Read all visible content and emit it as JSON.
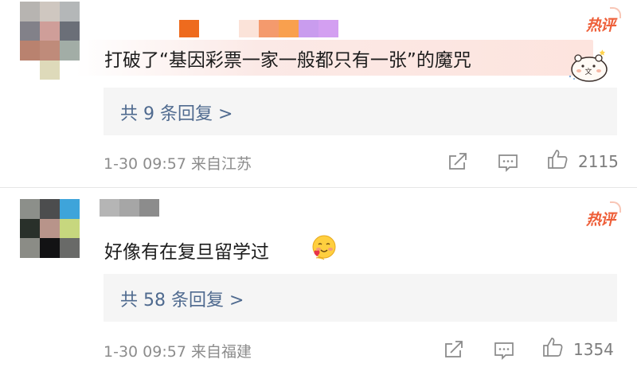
{
  "comments": [
    {
      "badge": "热评",
      "text": "打破了“基因彩票一家一般都只有一张”的魔咒",
      "reply_link": "共 9 条回复 >",
      "time": "1-30 09:57",
      "source": "来自江苏",
      "likes": "2115",
      "avatar_colors": [
        "#b7b4b1",
        "#cfc7c0",
        "#b4b7b8",
        "#828189",
        "#cf9e99",
        "#6b6f78",
        "#b9826f",
        "#bf8b7a",
        "#a2ada6",
        "#ffffff",
        "#dedaba",
        "#ffffff"
      ],
      "name_colors": [
        "#ffffff",
        "#ee6b1e",
        "#ffffff",
        "#fbe3d9",
        "#f49a6d",
        "#f9a04e",
        "#c99cee",
        "#d39ff1"
      ],
      "sticker": "bear-sticker"
    },
    {
      "badge": "热评",
      "text": "好像有在复旦留学过",
      "reply_link": "共 58 条回复 >",
      "time": "1-30 09:57",
      "source": "来自福建",
      "likes": "1354",
      "avatar_colors": [
        "#8c8f8a",
        "#4c4d4e",
        "#3ea4da",
        "#29302a",
        "#b8948a",
        "#c7d77e",
        "#8b8c86",
        "#121214",
        "#696a68"
      ],
      "name_colors": [
        "#b5b5b5",
        "#a6a6a6",
        "#8c8c8c"
      ],
      "emoji": "hugging-face-emoji"
    }
  ],
  "icons": {
    "share": "share-icon",
    "comment": "comment-icon",
    "like": "thumbs-up-icon"
  }
}
